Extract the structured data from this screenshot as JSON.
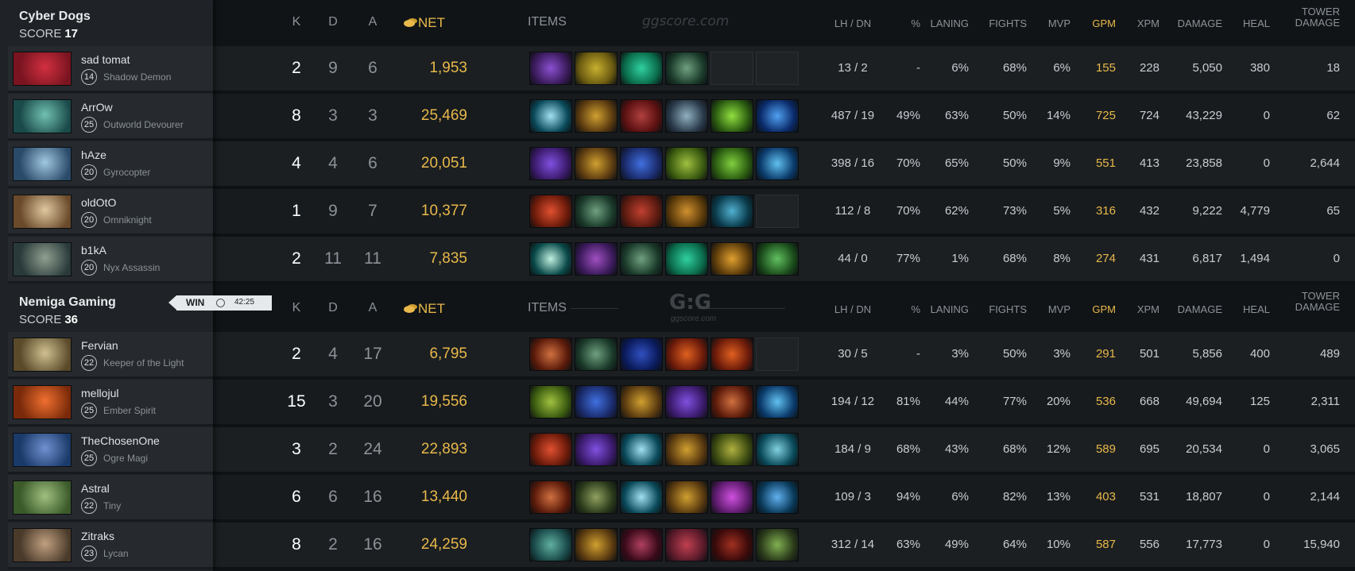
{
  "colors": {
    "accent_gold": "#e8b84a",
    "bg": "#101417",
    "sidebar_bg": "#1f2327"
  },
  "watermark": {
    "text": "ggscore.com",
    "logo": "G:G"
  },
  "match_status": {
    "result": "WIN",
    "icon": "clock-icon",
    "duration": "42:25"
  },
  "columns": {
    "k": "K",
    "d": "D",
    "a": "A",
    "net": "NET",
    "items": "ITEMS",
    "lh_dn": "LH / DN",
    "pct": "%",
    "laning": "LANING",
    "fights": "FIGHTS",
    "mvp": "MVP",
    "gpm": "GPM",
    "xpm": "XPM",
    "damage": "DAMAGE",
    "heal": "HEAL",
    "tower_1": "TOWER",
    "tower_2": "DAMAGE"
  },
  "teams": [
    {
      "name": "Cyber Dogs",
      "score_label": "SCORE",
      "score": "17",
      "players": [
        {
          "name": "sad tomat",
          "level": "14",
          "hero": "Shadow Demon",
          "k": "2",
          "d": "9",
          "a": "6",
          "net": "1,953",
          "lh_dn": "13 / 2",
          "pct": "-",
          "laning": "6%",
          "fights": "68%",
          "mvp": "6%",
          "gpm": "155",
          "xpm": "228",
          "damage": "5,050",
          "heal": "380",
          "tower": "18",
          "portrait": [
            "#7a1420",
            "#d23040"
          ],
          "items": [
            [
              "#3a1a5a",
              "#8a50d0"
            ],
            [
              "#6a5a10",
              "#c8b030"
            ],
            [
              "#0a6a4a",
              "#30d0a0"
            ],
            [
              "#1a3a2a",
              "#70a080"
            ],
            null,
            null
          ]
        },
        {
          "name": "ArrOw",
          "level": "25",
          "hero": "Outworld Devourer",
          "k": "8",
          "d": "3",
          "a": "3",
          "net": "25,469",
          "lh_dn": "487 / 19",
          "pct": "49%",
          "laning": "63%",
          "fights": "50%",
          "mvp": "14%",
          "gpm": "725",
          "xpm": "724",
          "damage": "43,229",
          "heal": "0",
          "tower": "62",
          "portrait": [
            "#1a4a4a",
            "#70c0b0"
          ],
          "items": [
            [
              "#0a4a5a",
              "#a0e0f0"
            ],
            [
              "#5a3a10",
              "#d0a030"
            ],
            [
              "#5a1010",
              "#b04040"
            ],
            [
              "#2a3a4a",
              "#90b0c0"
            ],
            [
              "#2a5a10",
              "#90e040"
            ],
            [
              "#0a2a6a",
              "#50a0f0"
            ]
          ]
        },
        {
          "name": "hAze",
          "level": "20",
          "hero": "Gyrocopter",
          "k": "4",
          "d": "4",
          "a": "6",
          "net": "20,051",
          "lh_dn": "398 / 16",
          "pct": "70%",
          "laning": "65%",
          "fights": "50%",
          "mvp": "9%",
          "gpm": "551",
          "xpm": "413",
          "damage": "23,858",
          "heal": "0",
          "tower": "2,644",
          "portrait": [
            "#2a4a6a",
            "#a0c8e0"
          ],
          "items": [
            [
              "#3a1a6a",
              "#8050e0"
            ],
            [
              "#5a3a10",
              "#d0a030"
            ],
            [
              "#1a2a6a",
              "#4070e0"
            ],
            [
              "#3a5a10",
              "#a0c040"
            ],
            [
              "#2a5a10",
              "#80d040"
            ],
            [
              "#0a3a6a",
              "#60c0f0"
            ]
          ]
        },
        {
          "name": "oldOtO",
          "level": "20",
          "hero": "Omniknight",
          "k": "1",
          "d": "9",
          "a": "7",
          "net": "10,377",
          "lh_dn": "112 / 8",
          "pct": "70%",
          "laning": "62%",
          "fights": "73%",
          "mvp": "5%",
          "gpm": "316",
          "xpm": "432",
          "damage": "9,222",
          "heal": "4,779",
          "tower": "65",
          "portrait": [
            "#6a4a2a",
            "#e0c8a0"
          ],
          "items": [
            [
              "#6a1a0a",
              "#e05030"
            ],
            [
              "#1a3a2a",
              "#70a080"
            ],
            [
              "#5a1a10",
              "#c04030"
            ],
            [
              "#5a3a0a",
              "#d09030"
            ],
            [
              "#0a3a4a",
              "#50b0d0"
            ],
            null
          ]
        },
        {
          "name": "b1kA",
          "level": "20",
          "hero": "Nyx Assassin",
          "k": "2",
          "d": "11",
          "a": "11",
          "net": "7,835",
          "lh_dn": "44 / 0",
          "pct": "77%",
          "laning": "1%",
          "fights": "68%",
          "mvp": "8%",
          "gpm": "274",
          "xpm": "431",
          "damage": "6,817",
          "heal": "1,494",
          "tower": "0",
          "portrait": [
            "#2a3a3a",
            "#90a090"
          ],
          "items": [
            [
              "#0a4a4a",
              "#c0f0e0"
            ],
            [
              "#3a1a5a",
              "#a050c0"
            ],
            [
              "#1a3a2a",
              "#70a080"
            ],
            [
              "#0a6a4a",
              "#30d0a0"
            ],
            [
              "#5a3a0a",
              "#e0a030"
            ],
            [
              "#1a4a1a",
              "#60c060"
            ]
          ]
        }
      ]
    },
    {
      "name": "Nemiga Gaming",
      "score_label": "SCORE",
      "score": "36",
      "players": [
        {
          "name": "Fervian",
          "level": "22",
          "hero": "Keeper of the Light",
          "k": "2",
          "d": "4",
          "a": "17",
          "net": "6,795",
          "lh_dn": "30 / 5",
          "pct": "-",
          "laning": "3%",
          "fights": "50%",
          "mvp": "3%",
          "gpm": "291",
          "xpm": "501",
          "damage": "5,856",
          "heal": "400",
          "tower": "489",
          "portrait": [
            "#5a4a2a",
            "#d0c090"
          ],
          "items": [
            [
              "#5a1a0a",
              "#d07040"
            ],
            [
              "#1a3a2a",
              "#70a080"
            ],
            [
              "#0a1a5a",
              "#3050c0"
            ],
            [
              "#6a1a0a",
              "#e06020"
            ],
            [
              "#6a1a0a",
              "#e06020"
            ],
            null
          ]
        },
        {
          "name": "mellojul",
          "level": "25",
          "hero": "Ember Spirit",
          "k": "15",
          "d": "3",
          "a": "20",
          "net": "19,556",
          "lh_dn": "194 / 12",
          "pct": "81%",
          "laning": "44%",
          "fights": "77%",
          "mvp": "20%",
          "gpm": "536",
          "xpm": "668",
          "damage": "49,694",
          "heal": "125",
          "tower": "2,311",
          "portrait": [
            "#7a2a0a",
            "#f07030"
          ],
          "items": [
            [
              "#3a5a10",
              "#a0c040"
            ],
            [
              "#1a2a6a",
              "#4070e0"
            ],
            [
              "#5a3a10",
              "#d0a030"
            ],
            [
              "#3a1a6a",
              "#8050e0"
            ],
            [
              "#5a1a0a",
              "#d07040"
            ],
            [
              "#0a3a6a",
              "#60c0f0"
            ]
          ]
        },
        {
          "name": "TheChosenOne",
          "level": "25",
          "hero": "Ogre Magi",
          "k": "3",
          "d": "2",
          "a": "24",
          "net": "22,893",
          "lh_dn": "184 / 9",
          "pct": "68%",
          "laning": "43%",
          "fights": "68%",
          "mvp": "12%",
          "gpm": "589",
          "xpm": "695",
          "damage": "20,534",
          "heal": "0",
          "tower": "3,065",
          "portrait": [
            "#1a3a6a",
            "#7090d0"
          ],
          "items": [
            [
              "#6a1a0a",
              "#e05030"
            ],
            [
              "#3a1a6a",
              "#8050e0"
            ],
            [
              "#0a4a5a",
              "#a0e0f0"
            ],
            [
              "#5a3a10",
              "#d0a030"
            ],
            [
              "#3a4a10",
              "#b0b040"
            ],
            [
              "#0a4a5a",
              "#80d0e0"
            ]
          ]
        },
        {
          "name": "Astral",
          "level": "22",
          "hero": "Tiny",
          "k": "6",
          "d": "6",
          "a": "16",
          "net": "13,440",
          "lh_dn": "109 / 3",
          "pct": "94%",
          "laning": "6%",
          "fights": "82%",
          "mvp": "13%",
          "gpm": "403",
          "xpm": "531",
          "damage": "18,807",
          "heal": "0",
          "tower": "2,144",
          "portrait": [
            "#3a5a2a",
            "#a0c080"
          ],
          "items": [
            [
              "#5a1a0a",
              "#d07040"
            ],
            [
              "#2a3a1a",
              "#90a060"
            ],
            [
              "#0a4a5a",
              "#a0e0f0"
            ],
            [
              "#5a3a10",
              "#d0a030"
            ],
            [
              "#5a1a6a",
              "#d050e0"
            ],
            [
              "#0a3a5a",
              "#60b0f0"
            ]
          ]
        },
        {
          "name": "Zitraks",
          "level": "23",
          "hero": "Lycan",
          "k": "8",
          "d": "2",
          "a": "16",
          "net": "24,259",
          "lh_dn": "312 / 14",
          "pct": "63%",
          "laning": "49%",
          "fights": "64%",
          "mvp": "10%",
          "gpm": "587",
          "xpm": "556",
          "damage": "17,773",
          "heal": "0",
          "tower": "15,940",
          "portrait": [
            "#4a3a2a",
            "#c0a080"
          ],
          "items": [
            [
              "#1a4a4a",
              "#60b0a0"
            ],
            [
              "#5a3a10",
              "#d0a030"
            ],
            [
              "#3a0a1a",
              "#b04060"
            ],
            [
              "#5a1a2a",
              "#c04050"
            ],
            [
              "#3a0a0a",
              "#a03020"
            ],
            [
              "#2a3a1a",
              "#80b050"
            ]
          ]
        }
      ]
    }
  ]
}
